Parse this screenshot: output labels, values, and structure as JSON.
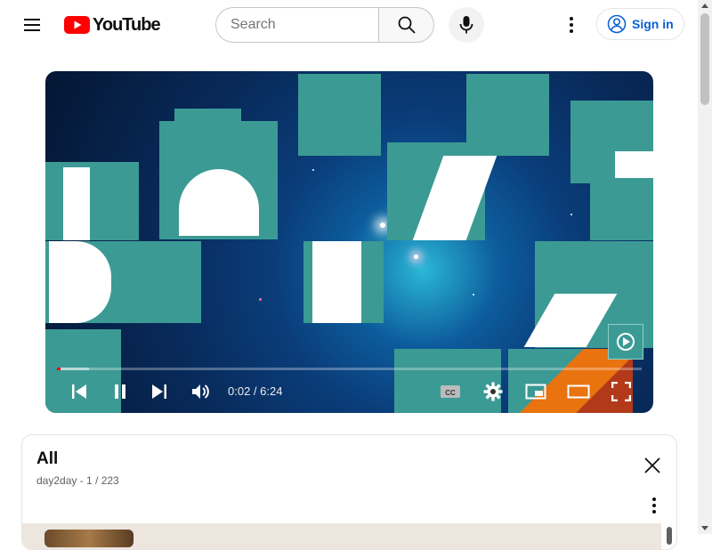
{
  "header": {
    "brand": "YouTube",
    "search_placeholder": "Search",
    "sign_in_label": "Sign in"
  },
  "player": {
    "current_time": "0:02",
    "duration": "6:24",
    "time_display": "0:02 / 6:24",
    "progress_fraction": 0.005,
    "buffered_fraction": 0.055
  },
  "playlist": {
    "title": "All",
    "meta": "day2day - 1 / 223"
  },
  "colors": {
    "accent": "#ff0000",
    "link": "#065fd4",
    "tile": "#3c9a94"
  },
  "icons": [
    "menu-icon",
    "youtube-logo-icon",
    "search-icon",
    "mic-icon",
    "more-vert-icon",
    "account-icon",
    "skip-previous-icon",
    "pause-icon",
    "skip-next-icon",
    "volume-icon",
    "captions-icon",
    "settings-icon",
    "miniplayer-icon",
    "theater-icon",
    "fullscreen-icon",
    "close-icon"
  ]
}
